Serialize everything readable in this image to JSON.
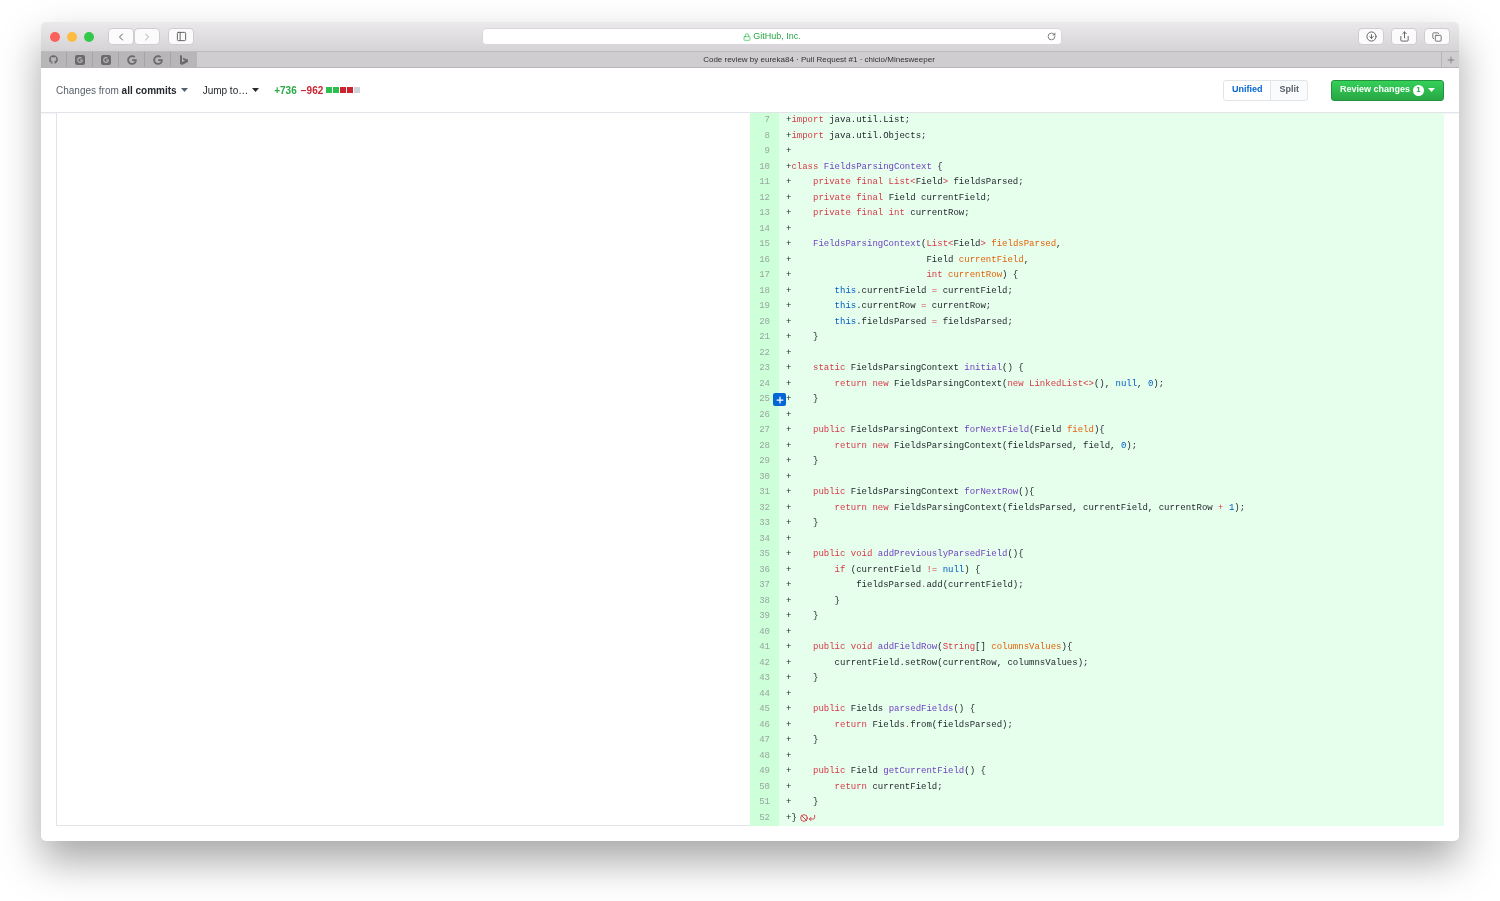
{
  "browser": {
    "address": "GitHub, Inc.",
    "tab_title": "Code review by eureka84 · Pull Request #1 · chicio/Minesweeper"
  },
  "toolbar": {
    "changes_filter": "Changes from **all commits**",
    "jump": "Jump to…",
    "additions": "+736",
    "deletions": "−962",
    "diffstat": [
      {
        "kind": "added"
      },
      {
        "kind": "added"
      },
      {
        "kind": "deleted"
      },
      {
        "kind": "deleted"
      },
      {
        "kind": "neutral"
      }
    ],
    "view_modes": [
      {
        "label": "Unified",
        "selected": true
      },
      {
        "label": "Split",
        "selected": false
      }
    ],
    "review": {
      "label": "Review changes",
      "badge": "1"
    }
  },
  "diff": {
    "lines": [
      {
        "number": "7",
        "marker": "+",
        "hover": false,
        "tokens": [
          {
            "kind": "kw",
            "text": "import"
          },
          {
            "kind": "plain",
            "text": " java.util.List;"
          }
        ]
      },
      {
        "number": "8",
        "marker": "+",
        "hover": false,
        "tokens": [
          {
            "kind": "kw",
            "text": "import"
          },
          {
            "kind": "plain",
            "text": " java.util.Objects;"
          }
        ]
      },
      {
        "number": "9",
        "marker": "+",
        "hover": false
      },
      {
        "number": "10",
        "marker": "+",
        "hover": false,
        "tokens": [
          {
            "kind": "kw",
            "text": "class "
          },
          {
            "kind": "ent",
            "text": "FieldsParsingContext"
          },
          {
            "kind": "plain",
            "text": " {"
          }
        ]
      },
      {
        "number": "11",
        "marker": "+",
        "hover": false,
        "tokens": [
          {
            "kind": "kw",
            "text": "    private final List<"
          },
          {
            "kind": "plain",
            "text": "Field"
          },
          {
            "kind": "kw",
            "text": ">"
          },
          {
            "kind": "plain",
            "text": " fieldsParsed;"
          }
        ]
      },
      {
        "number": "12",
        "marker": "+",
        "hover": false,
        "tokens": [
          {
            "kind": "kw",
            "text": "    private final"
          },
          {
            "kind": "plain",
            "text": " Field currentField;"
          }
        ]
      },
      {
        "number": "13",
        "marker": "+",
        "hover": false,
        "tokens": [
          {
            "kind": "kw",
            "text": "    private final int"
          },
          {
            "kind": "plain",
            "text": " currentRow;"
          }
        ]
      },
      {
        "number": "14",
        "marker": "+",
        "hover": false
      },
      {
        "number": "15",
        "marker": "+",
        "hover": false,
        "tokens": [
          {
            "kind": "ent",
            "text": "    FieldsParsingContext"
          },
          {
            "kind": "plain",
            "text": "("
          },
          {
            "kind": "kw",
            "text": "List<"
          },
          {
            "kind": "plain",
            "text": "Field"
          },
          {
            "kind": "kw",
            "text": "> "
          },
          {
            "kind": "var",
            "text": "fieldsParsed"
          },
          {
            "kind": "plain",
            "text": ","
          }
        ]
      },
      {
        "number": "16",
        "marker": "+",
        "hover": false,
        "tokens": [
          {
            "kind": "plain",
            "text": "                         Field "
          },
          {
            "kind": "var",
            "text": "currentField"
          },
          {
            "kind": "plain",
            "text": ","
          }
        ]
      },
      {
        "number": "17",
        "marker": "+",
        "hover": false,
        "tokens": [
          {
            "kind": "kw",
            "text": "                         int "
          },
          {
            "kind": "var",
            "text": "currentRow"
          },
          {
            "kind": "plain",
            "text": ") {"
          }
        ]
      },
      {
        "number": "18",
        "marker": "+",
        "hover": false,
        "tokens": [
          {
            "kind": "const",
            "text": "        this"
          },
          {
            "kind": "plain",
            "text": ".currentField "
          },
          {
            "kind": "kw",
            "text": "="
          },
          {
            "kind": "plain",
            "text": " currentField;"
          }
        ]
      },
      {
        "number": "19",
        "marker": "+",
        "hover": false,
        "tokens": [
          {
            "kind": "const",
            "text": "        this"
          },
          {
            "kind": "plain",
            "text": ".currentRow "
          },
          {
            "kind": "kw",
            "text": "="
          },
          {
            "kind": "plain",
            "text": " currentRow;"
          }
        ]
      },
      {
        "number": "20",
        "marker": "+",
        "hover": false,
        "tokens": [
          {
            "kind": "const",
            "text": "        this"
          },
          {
            "kind": "plain",
            "text": ".fieldsParsed "
          },
          {
            "kind": "kw",
            "text": "="
          },
          {
            "kind": "plain",
            "text": " fieldsParsed;"
          }
        ]
      },
      {
        "number": "21",
        "marker": "+",
        "hover": false,
        "tokens": [
          {
            "kind": "plain",
            "text": "    }"
          }
        ]
      },
      {
        "number": "22",
        "marker": "+",
        "hover": false
      },
      {
        "number": "23",
        "marker": "+",
        "hover": false,
        "tokens": [
          {
            "kind": "kw",
            "text": "    static"
          },
          {
            "kind": "plain",
            "text": " FieldsParsingContext "
          },
          {
            "kind": "ent",
            "text": "initial"
          },
          {
            "kind": "plain",
            "text": "() {"
          }
        ]
      },
      {
        "number": "24",
        "marker": "+",
        "hover": false,
        "tokens": [
          {
            "kind": "kw",
            "text": "        return new"
          },
          {
            "kind": "plain",
            "text": " FieldsParsingContext("
          },
          {
            "kind": "kw",
            "text": "new LinkedList<>"
          },
          {
            "kind": "plain",
            "text": "(), "
          },
          {
            "kind": "const",
            "text": "null"
          },
          {
            "kind": "plain",
            "text": ", "
          },
          {
            "kind": "const",
            "text": "0"
          },
          {
            "kind": "plain",
            "text": ");"
          }
        ]
      },
      {
        "number": "25",
        "marker": "+",
        "hover": true,
        "tokens": [
          {
            "kind": "plain",
            "text": "    }"
          }
        ]
      },
      {
        "number": "26",
        "marker": "+",
        "hover": false
      },
      {
        "number": "27",
        "marker": "+",
        "hover": false,
        "tokens": [
          {
            "kind": "kw",
            "text": "    public"
          },
          {
            "kind": "plain",
            "text": " FieldsParsingContext "
          },
          {
            "kind": "ent",
            "text": "forNextField"
          },
          {
            "kind": "plain",
            "text": "(Field "
          },
          {
            "kind": "var",
            "text": "field"
          },
          {
            "kind": "plain",
            "text": "){"
          }
        ]
      },
      {
        "number": "28",
        "marker": "+",
        "hover": false,
        "tokens": [
          {
            "kind": "kw",
            "text": "        return new"
          },
          {
            "kind": "plain",
            "text": " FieldsParsingContext(fieldsParsed, field, "
          },
          {
            "kind": "const",
            "text": "0"
          },
          {
            "kind": "plain",
            "text": ");"
          }
        ]
      },
      {
        "number": "29",
        "marker": "+",
        "hover": false,
        "tokens": [
          {
            "kind": "plain",
            "text": "    }"
          }
        ]
      },
      {
        "number": "30",
        "marker": "+",
        "hover": false
      },
      {
        "number": "31",
        "marker": "+",
        "hover": false,
        "tokens": [
          {
            "kind": "kw",
            "text": "    public"
          },
          {
            "kind": "plain",
            "text": " FieldsParsingContext "
          },
          {
            "kind": "ent",
            "text": "forNextRow"
          },
          {
            "kind": "plain",
            "text": "(){"
          }
        ]
      },
      {
        "number": "32",
        "marker": "+",
        "hover": false,
        "tokens": [
          {
            "kind": "kw",
            "text": "        return new"
          },
          {
            "kind": "plain",
            "text": " FieldsParsingContext(fieldsParsed, currentField, currentRow "
          },
          {
            "kind": "kw",
            "text": "+"
          },
          {
            "kind": "const",
            "text": " 1"
          },
          {
            "kind": "plain",
            "text": ");"
          }
        ]
      },
      {
        "number": "33",
        "marker": "+",
        "hover": false,
        "tokens": [
          {
            "kind": "plain",
            "text": "    }"
          }
        ]
      },
      {
        "number": "34",
        "marker": "+",
        "hover": false
      },
      {
        "number": "35",
        "marker": "+",
        "hover": false,
        "tokens": [
          {
            "kind": "kw",
            "text": "    public void "
          },
          {
            "kind": "ent",
            "text": "addPreviouslyParsedField"
          },
          {
            "kind": "plain",
            "text": "(){"
          }
        ]
      },
      {
        "number": "36",
        "marker": "+",
        "hover": false,
        "tokens": [
          {
            "kind": "kw",
            "text": "        if"
          },
          {
            "kind": "plain",
            "text": " (currentField "
          },
          {
            "kind": "kw",
            "text": "!="
          },
          {
            "kind": "const",
            "text": " null"
          },
          {
            "kind": "plain",
            "text": ") {"
          }
        ]
      },
      {
        "number": "37",
        "marker": "+",
        "hover": false,
        "tokens": [
          {
            "kind": "plain",
            "text": "            fieldsParsed"
          },
          {
            "kind": "kw",
            "text": "."
          },
          {
            "kind": "plain",
            "text": "add(currentField);"
          }
        ]
      },
      {
        "number": "38",
        "marker": "+",
        "hover": false,
        "tokens": [
          {
            "kind": "plain",
            "text": "        }"
          }
        ]
      },
      {
        "number": "39",
        "marker": "+",
        "hover": false,
        "tokens": [
          {
            "kind": "plain",
            "text": "    }"
          }
        ]
      },
      {
        "number": "40",
        "marker": "+",
        "hover": false
      },
      {
        "number": "41",
        "marker": "+",
        "hover": false,
        "tokens": [
          {
            "kind": "kw",
            "text": "    public void "
          },
          {
            "kind": "ent",
            "text": "addFieldRow"
          },
          {
            "kind": "plain",
            "text": "("
          },
          {
            "kind": "kw",
            "text": "String"
          },
          {
            "kind": "plain",
            "text": "[] "
          },
          {
            "kind": "var",
            "text": "columnsValues"
          },
          {
            "kind": "plain",
            "text": "){"
          }
        ]
      },
      {
        "number": "42",
        "marker": "+",
        "hover": false,
        "tokens": [
          {
            "kind": "plain",
            "text": "        currentField.setRow(currentRow, columnsValues);"
          }
        ]
      },
      {
        "number": "43",
        "marker": "+",
        "hover": false,
        "tokens": [
          {
            "kind": "plain",
            "text": "    }"
          }
        ]
      },
      {
        "number": "44",
        "marker": "+",
        "hover": false
      },
      {
        "number": "45",
        "marker": "+",
        "hover": false,
        "tokens": [
          {
            "kind": "kw",
            "text": "    public"
          },
          {
            "kind": "plain",
            "text": " Fields "
          },
          {
            "kind": "ent",
            "text": "parsedFields"
          },
          {
            "kind": "plain",
            "text": "() {"
          }
        ]
      },
      {
        "number": "46",
        "marker": "+",
        "hover": false,
        "tokens": [
          {
            "kind": "kw",
            "text": "        return"
          },
          {
            "kind": "plain",
            "text": " Fields"
          },
          {
            "kind": "kw",
            "text": "."
          },
          {
            "kind": "plain",
            "text": "from(fieldsParsed);"
          }
        ]
      },
      {
        "number": "47",
        "marker": "+",
        "hover": false,
        "tokens": [
          {
            "kind": "plain",
            "text": "    }"
          }
        ]
      },
      {
        "number": "48",
        "marker": "+",
        "hover": false
      },
      {
        "number": "49",
        "marker": "+",
        "hover": false,
        "tokens": [
          {
            "kind": "kw",
            "text": "    public"
          },
          {
            "kind": "plain",
            "text": " Field "
          },
          {
            "kind": "ent",
            "text": "getCurrentField"
          },
          {
            "kind": "plain",
            "text": "() {"
          }
        ]
      },
      {
        "number": "50",
        "marker": "+",
        "hover": false,
        "tokens": [
          {
            "kind": "kw",
            "text": "        return"
          },
          {
            "kind": "plain",
            "text": " currentField;"
          }
        ]
      },
      {
        "number": "51",
        "marker": "+",
        "hover": false,
        "tokens": [
          {
            "kind": "plain",
            "text": "    }"
          }
        ]
      },
      {
        "number": "52",
        "marker": "+",
        "hover": false,
        "no_newline": true,
        "tokens": [
          {
            "kind": "plain",
            "text": "}"
          }
        ]
      }
    ]
  }
}
